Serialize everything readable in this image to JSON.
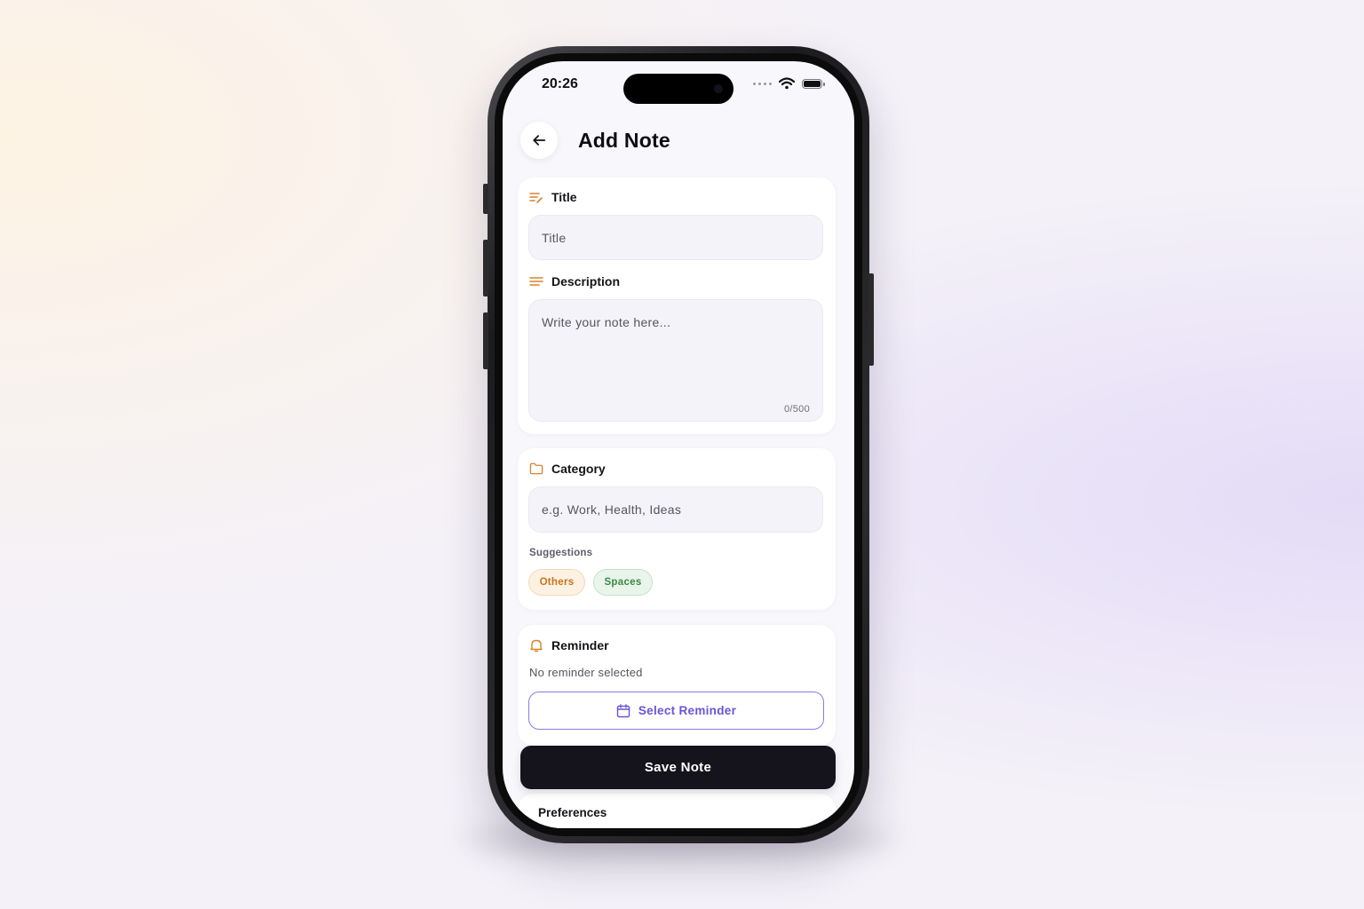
{
  "status_bar": {
    "time": "20:26",
    "battery_level": 1.0
  },
  "header": {
    "title": "Add Note",
    "back_icon": "arrow-left-icon"
  },
  "form": {
    "title": {
      "label": "Title",
      "icon": "title-edit-icon",
      "placeholder": "Title",
      "value": ""
    },
    "description": {
      "label": "Description",
      "icon": "lines-icon",
      "placeholder": "Write your note here...",
      "value": "",
      "counter": "0/500"
    },
    "category": {
      "label": "Category",
      "icon": "folder-icon",
      "placeholder": "e.g. Work, Health, Ideas",
      "value": "",
      "suggestions_label": "Suggestions",
      "suggestions": [
        "Others",
        "Spaces"
      ]
    },
    "reminder": {
      "label": "Reminder",
      "icon": "bell-icon",
      "status": "No reminder selected",
      "button_label": "Select Reminder",
      "button_icon": "calendar-icon"
    }
  },
  "actions": {
    "save_label": "Save Note"
  },
  "preferences": {
    "label": "Preferences"
  },
  "colors": {
    "accent_orange": "#d9822b",
    "accent_purple": "#6b53d6",
    "chip_green": "#3a8a45",
    "primary_dark": "#15141c"
  }
}
